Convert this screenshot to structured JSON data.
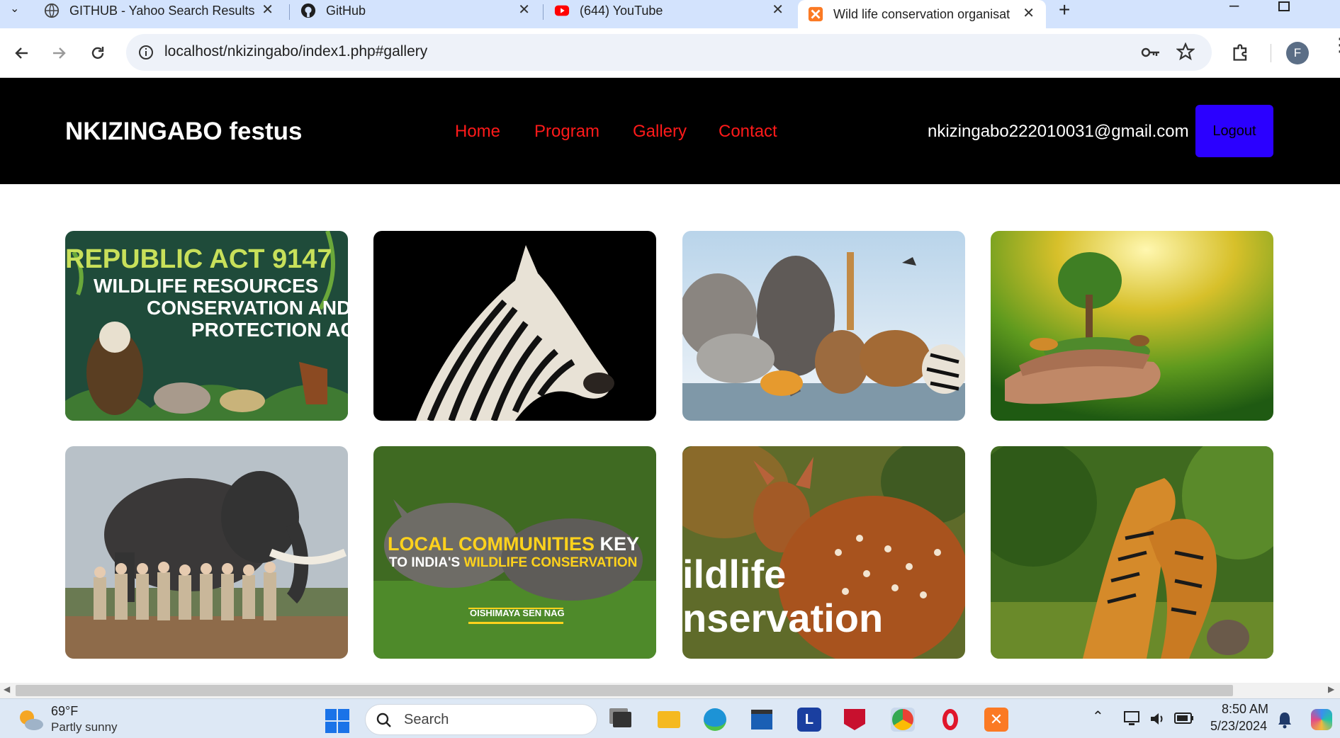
{
  "browser": {
    "tabs": [
      {
        "title": "GITHUB - Yahoo Search Results",
        "icon": "search-icon"
      },
      {
        "title": "GitHub",
        "icon": "github-icon"
      },
      {
        "title": "(644) YouTube",
        "icon": "youtube-icon"
      },
      {
        "title": "Wild life conservation organisat",
        "icon": "xampp-icon"
      }
    ],
    "url": "localhost/nkizingabo/index1.php#gallery",
    "profile_initial": "F"
  },
  "site": {
    "brand": "NKIZINGABO festus",
    "nav": [
      "Home",
      "Program",
      "Gallery",
      "Contact"
    ],
    "user_email": "nkizingabo222010031@gmail.com",
    "logout_label": "Logout"
  },
  "gallery": {
    "img1": {
      "line1": "REPUBLIC ACT 9147",
      "line2": "WILDLIFE RESOURCES",
      "line3": "CONSERVATION AND",
      "line4": "PROTECTION AC"
    },
    "img6": {
      "line1a": "LOCAL COMMUNITIES",
      "line1b": " KEY",
      "line2a": "TO INDIA'S ",
      "line2b": "WILDLIFE CONSERVATION",
      "author": "OISHIMAYA SEN NAG"
    },
    "img7": {
      "line1": "ildlife",
      "line2": "nservation"
    }
  },
  "taskbar": {
    "weather_temp": "69°F",
    "weather_desc": "Partly sunny",
    "search_placeholder": "Search",
    "time": "8:50 AM",
    "date": "5/23/2024"
  },
  "colors": {
    "tabstrip": "#d3e3fd",
    "header_bg": "#000000",
    "nav_link": "#ff1a1a",
    "logout_bg": "#2b00ff"
  }
}
